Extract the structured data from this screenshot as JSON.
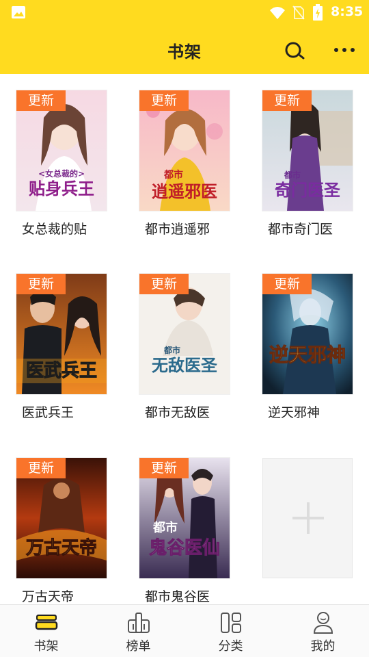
{
  "status_bar": {
    "time": "8:35",
    "icons": [
      "gallery-icon",
      "wifi-icon",
      "no-sim-icon",
      "battery-charging-icon"
    ]
  },
  "app_bar": {
    "title": "书架",
    "actions": [
      "search-icon",
      "more-icon"
    ]
  },
  "shelf": {
    "badge_label": "更新",
    "books": [
      {
        "title": "女总裁的贴",
        "cover_text": "贴身兵王",
        "cover_subtitle": "<女总裁的>",
        "updated": true
      },
      {
        "title": "都市逍遥邪",
        "cover_text": "逍遥邪医",
        "cover_subtitle": "都市",
        "updated": true
      },
      {
        "title": "都市奇门医",
        "cover_text": "奇门医圣",
        "cover_subtitle": "都市",
        "updated": true
      },
      {
        "title": "医武兵王",
        "cover_text": "医武兵王",
        "cover_subtitle": "",
        "updated": true
      },
      {
        "title": "都市无敌医",
        "cover_text": "无敌医圣",
        "cover_subtitle": "都市",
        "updated": true
      },
      {
        "title": "逆天邪神",
        "cover_text": "逆天邪神",
        "cover_subtitle": "",
        "updated": true
      },
      {
        "title": "万古天帝",
        "cover_text": "万古天帝",
        "cover_subtitle": "",
        "updated": true
      },
      {
        "title": "都市鬼谷医",
        "cover_text": "鬼谷医仙",
        "cover_subtitle": "都市",
        "updated": true
      }
    ],
    "add_icon": "plus-icon"
  },
  "bottom_nav": {
    "items": [
      {
        "label": "书架",
        "icon": "bookshelf-icon",
        "active": true
      },
      {
        "label": "榜单",
        "icon": "ranking-icon",
        "active": false
      },
      {
        "label": "分类",
        "icon": "category-icon",
        "active": false
      },
      {
        "label": "我的",
        "icon": "profile-icon",
        "active": false
      }
    ]
  },
  "colors": {
    "accent": "#FFDB1F",
    "badge": "#F9742B",
    "text": "#222222"
  }
}
